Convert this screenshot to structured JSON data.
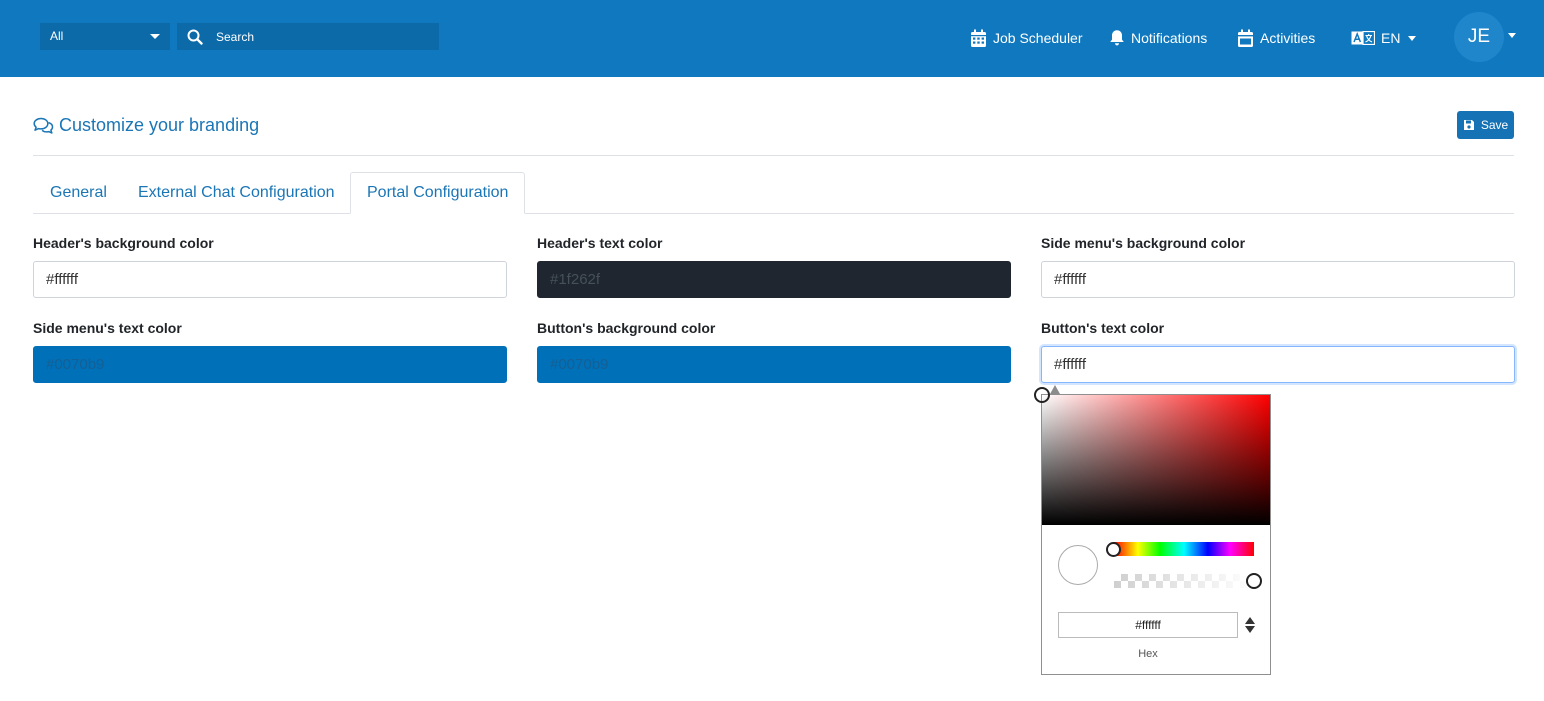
{
  "topbar": {
    "scope_select": "All",
    "search_placeholder": "Search",
    "nav": {
      "job_scheduler": "Job Scheduler",
      "notifications": "Notifications",
      "activities": "Activities",
      "language": "EN"
    },
    "avatar_initials": "JE",
    "background": "#0f78be"
  },
  "page": {
    "title": "Customize your branding",
    "save_label": "Save"
  },
  "tabs": [
    {
      "label": "General",
      "active": false
    },
    {
      "label": "External Chat Configuration",
      "active": false
    },
    {
      "label": "Portal Configuration",
      "active": true
    }
  ],
  "fields": {
    "header_bg": {
      "label": "Header's background color",
      "value": "#ffffff"
    },
    "header_text": {
      "label": "Header's text color",
      "value": "#1f262f"
    },
    "side_menu_bg": {
      "label": "Side menu's background color",
      "value": "#ffffff"
    },
    "side_menu_text": {
      "label": "Side menu's text color",
      "value": "#0070b9"
    },
    "button_bg": {
      "label": "Button's background color",
      "value": "#0070b9"
    },
    "button_text": {
      "label": "Button's text color",
      "value": "#ffffff"
    }
  },
  "color_picker": {
    "hex_value": "#ffffff",
    "mode_label": "Hex",
    "hue": 0,
    "alpha": 1
  },
  "icons": [
    "search-icon",
    "calendar-icon",
    "bell-icon",
    "calendar-check-icon",
    "translate-icon",
    "comments-icon",
    "save-icon"
  ]
}
